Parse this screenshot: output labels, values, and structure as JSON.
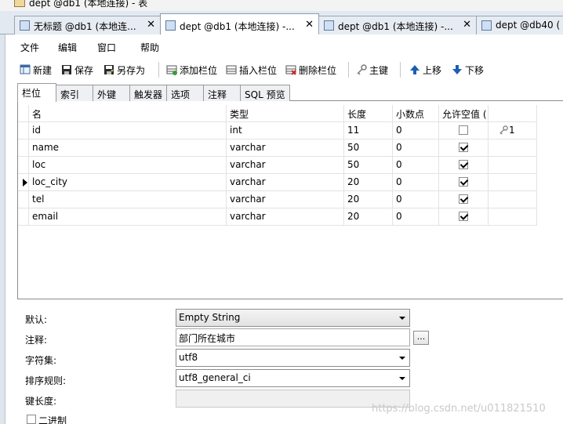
{
  "window": {
    "title": "dept @db1 (本地连接) - 表"
  },
  "tabs": [
    {
      "label": "无标题 @db1 (本地连...",
      "close": "✕",
      "active": false
    },
    {
      "label": "dept @db1 (本地连接) -...",
      "close": "✕",
      "active": true
    },
    {
      "label": "dept @db1 (本地连接) -...",
      "close": "✕",
      "active": false
    },
    {
      "label": "dept @db40 (",
      "close": "",
      "active": false
    }
  ],
  "menu": [
    "文件",
    "编辑",
    "窗口",
    "帮助"
  ],
  "toolbar": {
    "new_label": "新建",
    "save_label": "保存",
    "save_as_label": "另存为",
    "add_field_label": "添加栏位",
    "insert_field_label": "插入栏位",
    "delete_field_label": "删除栏位",
    "primary_key_label": "主键",
    "move_up_label": "上移",
    "move_down_label": "下移"
  },
  "subtabs": [
    "栏位",
    "索引",
    "外键",
    "触发器",
    "选项",
    "注释",
    "SQL 预览"
  ],
  "grid": {
    "headers": [
      "名",
      "类型",
      "长度",
      "小数点",
      "允许空值 ("
    ],
    "rows": [
      {
        "name": "id",
        "type": "int",
        "length": "11",
        "decimals": "0",
        "nullable": false,
        "key": "1",
        "current": false
      },
      {
        "name": "name",
        "type": "varchar",
        "length": "50",
        "decimals": "0",
        "nullable": true,
        "key": "",
        "current": false
      },
      {
        "name": "loc",
        "type": "varchar",
        "length": "50",
        "decimals": "0",
        "nullable": true,
        "key": "",
        "current": false
      },
      {
        "name": "loc_city",
        "type": "varchar",
        "length": "20",
        "decimals": "0",
        "nullable": true,
        "key": "",
        "current": true
      },
      {
        "name": "tel",
        "type": "varchar",
        "length": "20",
        "decimals": "0",
        "nullable": true,
        "key": "",
        "current": false
      },
      {
        "name": "email",
        "type": "varchar",
        "length": "20",
        "decimals": "0",
        "nullable": true,
        "key": "",
        "current": false
      }
    ]
  },
  "props": {
    "default_label": "默认:",
    "default_value": "Empty String",
    "comment_label": "注释:",
    "comment_value": "部门所在城市",
    "comment_button": "...",
    "charset_label": "字符集:",
    "charset_value": "utf8",
    "collation_label": "排序规则:",
    "collation_value": "utf8_general_ci",
    "key_length_label": "键长度:",
    "key_length_value": "",
    "binary_label": "二进制",
    "binary_checked": false
  },
  "watermark": "https://blog.csdn.net/u011821510",
  "colors": {
    "tab_bar": "#e3e9f1",
    "accent": "#1b5fb4"
  },
  "icons": [
    "table-icon",
    "new-icon",
    "save-icon",
    "save-as-icon",
    "add-field-icon",
    "insert-field-icon",
    "delete-field-icon",
    "key-icon",
    "arrow-up-icon",
    "arrow-down-icon"
  ]
}
